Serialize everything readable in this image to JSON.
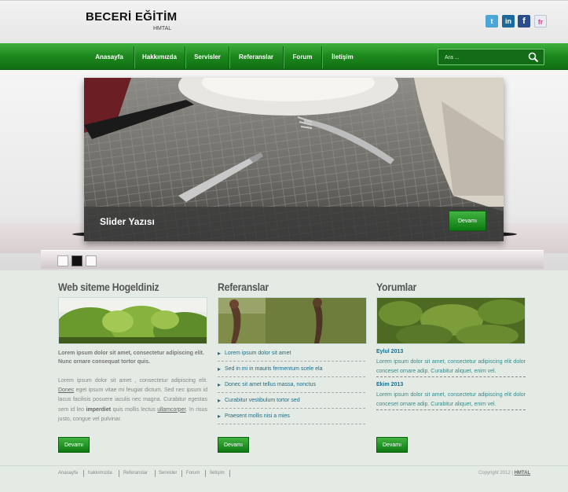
{
  "header": {
    "title": "BECERİ EĞİTİM",
    "subtitle": "HMTAL",
    "social": [
      {
        "name": "twitter-icon",
        "glyph": "t",
        "color": "#4aa6d6"
      },
      {
        "name": "linkedin-icon",
        "glyph": "in",
        "color": "#1b6a9e"
      },
      {
        "name": "facebook-icon",
        "glyph": "f",
        "color": "#2b4d8c"
      },
      {
        "name": "friendfeed-icon",
        "glyph": "fr",
        "color": "#e9edf3"
      }
    ]
  },
  "nav": {
    "items": [
      "Anasayfa",
      "Hakkımızda",
      "Servisler",
      "Referanslar",
      "Forum",
      "İletişim"
    ],
    "search_placeholder": "Ara ..."
  },
  "slider": {
    "caption": "Slider Yazısı",
    "button": "Devamı"
  },
  "columns": {
    "welcome": {
      "title": "Web siteme Hogeldiniz",
      "lead": "Lorem ipsum dolor sit amet, consectetur adipiscing elit. Nunc ornare consequat tortor quis.",
      "body": {
        "p1": "Lorem ipsum dolor sit amet , consectetur adipiscing elit.",
        "link1": "Donec",
        "p2": "eget ipsum vitae mi feugiat dictum. Sed nec ipsum id lacus facilisis posuere iaculis nec magna. Curabitur egestas sem id leo",
        "strong": "imperdiet",
        "p3": "quis mollis lectus",
        "link2": "ullamcorper",
        "p4": ". In risus justo, congue vel pulvinar."
      },
      "button": "Devamı"
    },
    "references": {
      "title": "Referanslar",
      "items": [
        "Lorem ipsum dolor sit amet",
        "Sed in mi in mauris fermentum scele ela",
        "Donec sit amet tellus massa, nonctus",
        "Curabitur vestibulum tortor sed",
        "Praesent mollis nisi a mies"
      ],
      "button": "Devamı"
    },
    "comments": {
      "title": "Yorumlar",
      "entries": [
        {
          "date": "Eylul 2013",
          "text": "Lorem ipsum dolor sit amet, consectetur adipiscing elit dolor conceset ornare adip. Curabitur aliquet, enim vel."
        },
        {
          "date": "Ekim 2013",
          "text": "Lorem ipsum dolor sit amet, consectetur adipiscing elit dolor conceset ornare adip. Curabitur aliquet, enim vel."
        }
      ],
      "button": "Devamı"
    }
  },
  "footer": {
    "links": [
      "Anasayfa",
      "hakkımızda",
      "Referanslar",
      "Servisler",
      "Forum",
      "İletişim"
    ],
    "copyright": "Copyright 2012 |",
    "brand": "HMTAL"
  }
}
